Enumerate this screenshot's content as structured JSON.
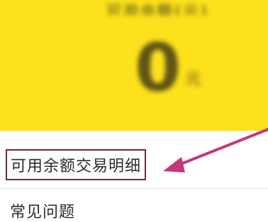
{
  "header": {
    "caption": "可用余额(元)",
    "balance": "0",
    "unit": "元"
  },
  "menu": {
    "items": [
      {
        "label": "可用余额交易明细"
      },
      {
        "label": "常见问题"
      }
    ]
  },
  "colors": {
    "header_background": "#FCE11C",
    "highlight_border": "#6e2a3b",
    "arrow": "#c7357a"
  }
}
